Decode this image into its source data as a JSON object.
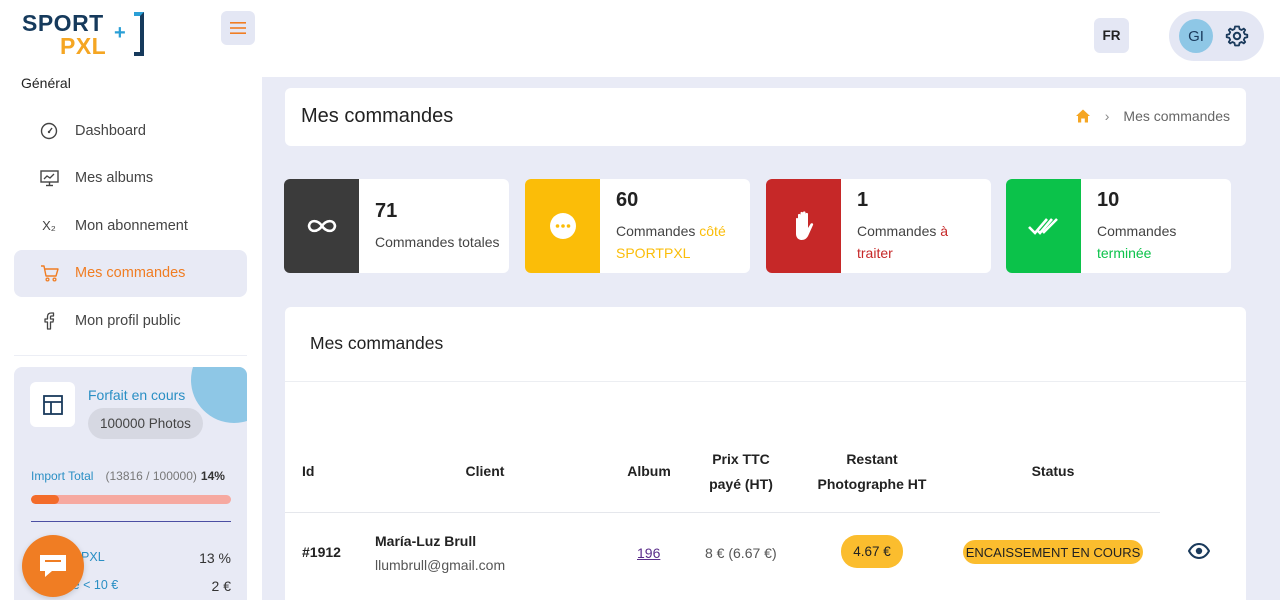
{
  "logo": {
    "line1": "SPORT",
    "line2": "PXL",
    "plus": "+"
  },
  "sidebar": {
    "section": "Général",
    "items": [
      {
        "label": "Dashboard",
        "icon": "gauge-icon"
      },
      {
        "label": "Mes albums",
        "icon": "presentation-icon"
      },
      {
        "label": "Mon abonnement",
        "icon": "subscript-icon",
        "icon_text": "X₂"
      },
      {
        "label": "Mes commandes",
        "icon": "cart-icon",
        "active": true
      },
      {
        "label": "Mon profil public",
        "icon": "facebook-icon"
      }
    ],
    "plan": {
      "title": "Forfait en cours",
      "badge": "100000 Photos",
      "import_label": "Import Total",
      "import_detail": "(13816 / 100000)",
      "import_pct": "14%",
      "import_fraction": 0.14,
      "row1_label": "ion SportPXL",
      "row1_value": "13 %",
      "row2_label": "mmande < 10 €",
      "row2_value": "2 €"
    }
  },
  "header": {
    "lang": "FR",
    "user_initials": "GI"
  },
  "page": {
    "title": "Mes commandes",
    "breadcrumb_current": "Mes commandes"
  },
  "stats": [
    {
      "value": "71",
      "label_a": "Commandes totales",
      "label_b": "",
      "color": "#3b3b3b",
      "icon": "infinity-icon"
    },
    {
      "value": "60",
      "label_a": "Commandes ",
      "label_b": "côté SPORTPXL",
      "color": "#fbbd08",
      "icon": "dots-icon"
    },
    {
      "value": "1",
      "label_a": "Commandes ",
      "label_b": "à traiter",
      "color": "#c62828",
      "icon": "hand-icon"
    },
    {
      "value": "10",
      "label_a": "Commandes ",
      "label_b": "terminée",
      "color": "#0bc24a",
      "icon": "double-check-icon"
    }
  ],
  "orders": {
    "title": "Mes commandes",
    "columns": {
      "id": "Id",
      "client": "Client",
      "album": "Album",
      "price_1": "Prix TTC",
      "price_2": "payé (HT)",
      "rest_1": "Restant",
      "rest_2": "Photographe HT",
      "status": "Status"
    },
    "rows": [
      {
        "id": "#1912",
        "client_name": "María-Luz Brull",
        "client_email": "llumbrull@gmail.com",
        "album": "196",
        "price": "8 € (6.67 €)",
        "rest": "4.67 €",
        "status": "ENCAISSEMENT EN COURS"
      }
    ]
  },
  "colors": {
    "accent": "#f07d23",
    "blue": "#2a8fc4",
    "bg": "#e9ebf6"
  }
}
